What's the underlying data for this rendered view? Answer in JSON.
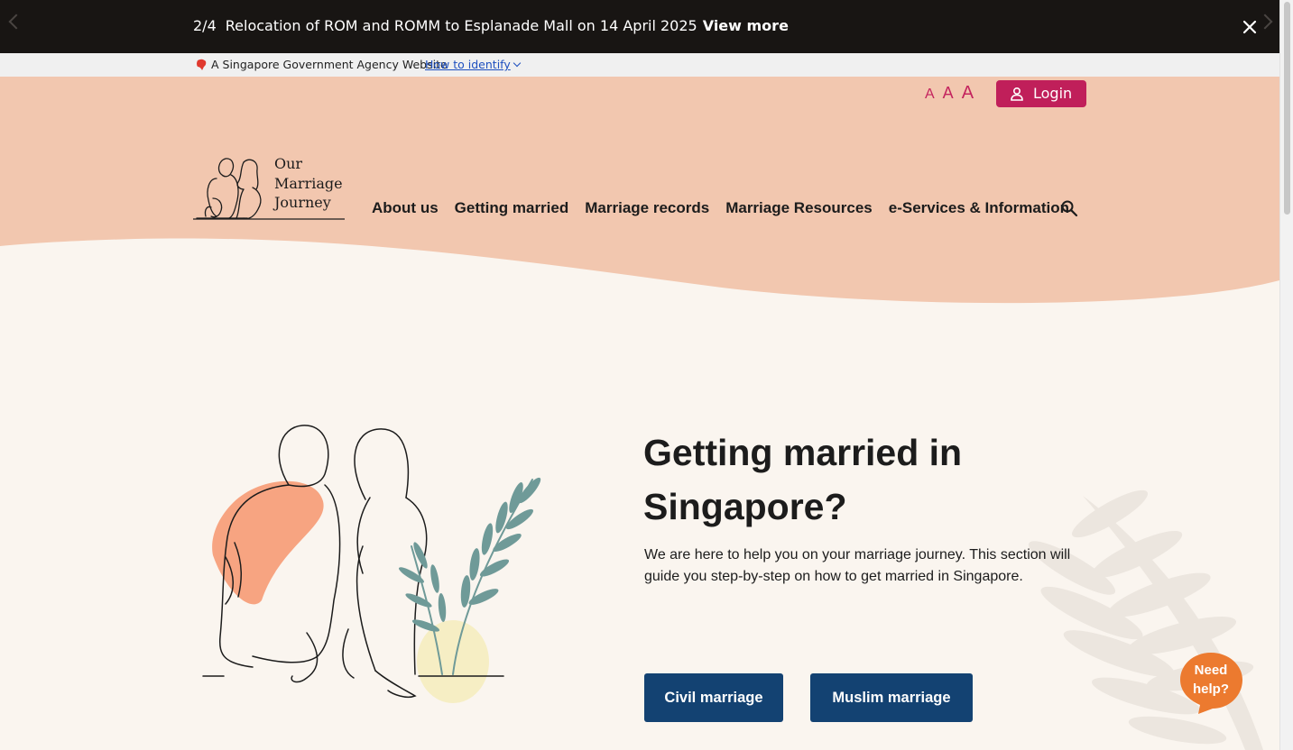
{
  "announcement": {
    "counter": "2/4",
    "message": "Relocation of ROM and ROMM to Esplanade Mall on 14 April 2025",
    "link_label": "View more",
    "icons": {
      "prev": "chevron-left-icon",
      "next": "chevron-right-icon",
      "close": "close-icon"
    }
  },
  "gov_bar": {
    "text": "A Singapore Government Agency Website",
    "link": "How to identify",
    "icon": "lion-head-icon"
  },
  "header": {
    "font_size_options": [
      "A",
      "A",
      "A"
    ],
    "login_label": "Login",
    "logo_lines": [
      "Our",
      "Marriage",
      "Journey"
    ],
    "nav_items": [
      "About us",
      "Getting married",
      "Marriage records",
      "Marriage Resources",
      "e-Services & Information"
    ],
    "search_icon": "search-icon"
  },
  "hero": {
    "title": "Getting married in Singapore?",
    "description": "We are here to help you on your marriage journey. This section will guide you step-by-step on how to get married in Singapore.",
    "buttons": [
      "Civil marriage",
      "Muslim marriage"
    ]
  },
  "help": {
    "label": "Need help?"
  },
  "colors": {
    "announcement_bg": "#181513",
    "header_peach": "#f2c7af",
    "page_bg": "#faf5ef",
    "accent_pink": "#c01f5a",
    "button_navy": "#134272",
    "help_orange": "#ec7a2f",
    "illustration_orange": "#f7a481",
    "illustration_yellow": "#f6eec4",
    "leaf_teal": "#6f9a98"
  }
}
